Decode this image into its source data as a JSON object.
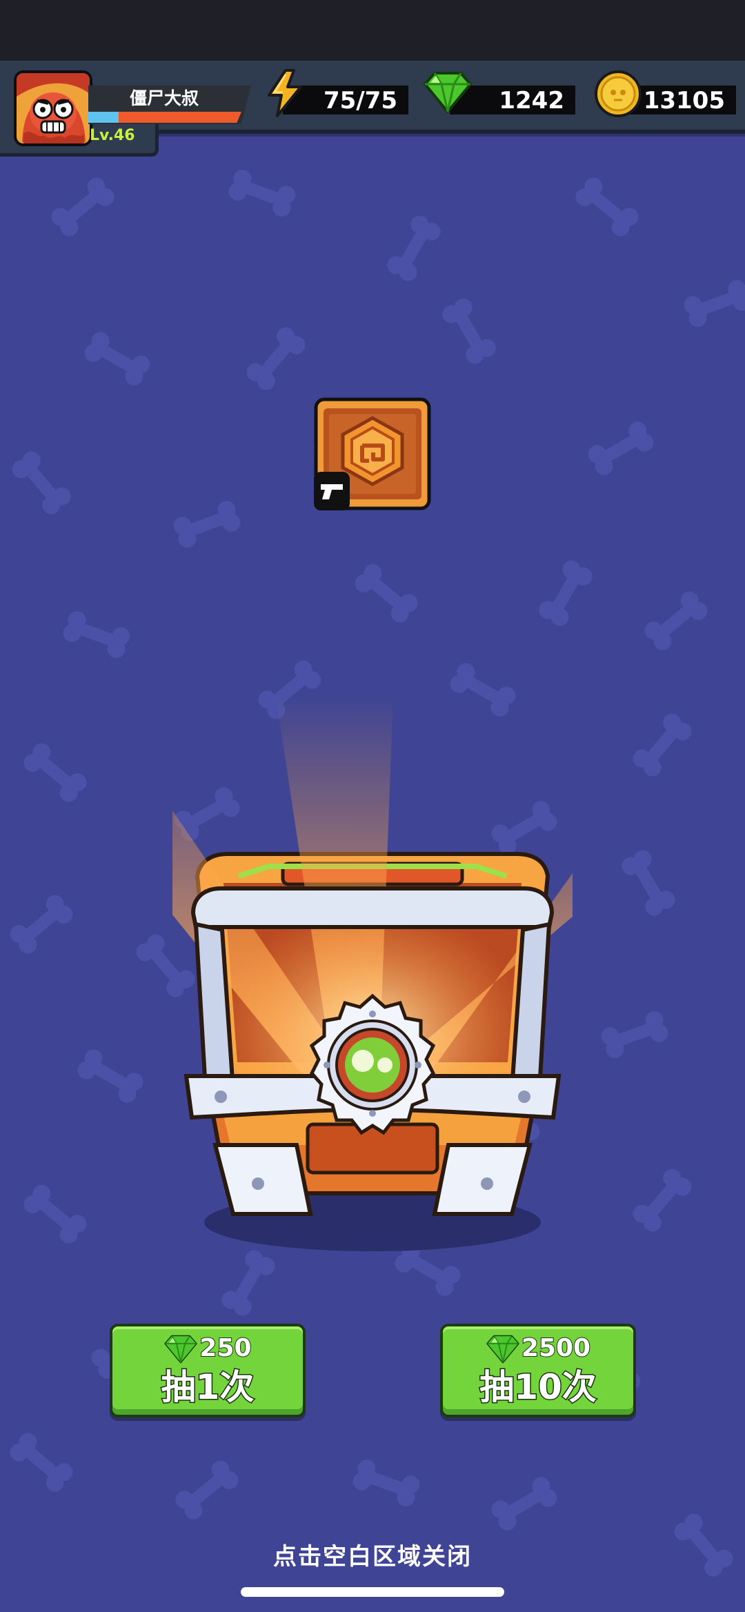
{
  "player": {
    "name": "僵尸大叔",
    "level": "Lv.46",
    "xp_fraction": 0.2
  },
  "resources": {
    "energy": "75/75",
    "gems": "1242",
    "coins": "13105"
  },
  "reward": {
    "icon": "gun-icon",
    "item_icon": "orange-hex-gear-emblem-icon"
  },
  "chest": {
    "icon": "treasure-chest-icon",
    "emblem": "green-skull-icon"
  },
  "draw_buttons": [
    {
      "price": "250",
      "label": "抽1次",
      "currency_icon": "gem-icon"
    },
    {
      "price": "2500",
      "label": "抽10次",
      "currency_icon": "gem-icon"
    }
  ],
  "close_hint": "点击空白区域关闭",
  "colors": {
    "background": "#3f4594",
    "top_bar": "#2f3c4f",
    "button_green": "#74d43c",
    "level_text": "#c9ef43",
    "xp_blue": "#5fc3f0",
    "xp_red": "#ef5a2c"
  }
}
